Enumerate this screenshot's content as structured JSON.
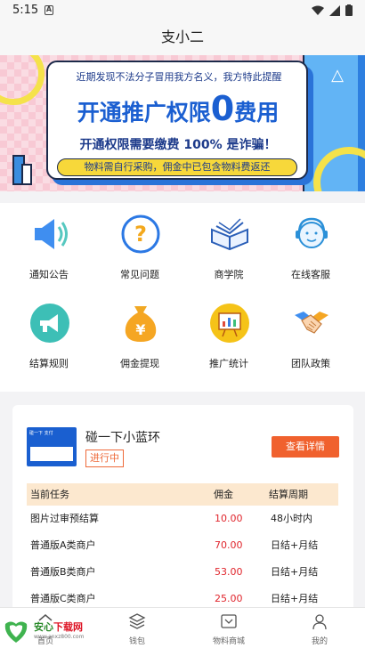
{
  "status_bar": {
    "time": "5:15",
    "notif_letter": "A"
  },
  "header": {
    "title": "支小二"
  },
  "banner": {
    "line1": "近期发现不法分子冒用我方名义，我方特此提醒",
    "line2_a": "开通推广权限",
    "line2_zero": "0",
    "line2_b": "费用",
    "line3": "开通权限需要缴费 100% 是诈骗！",
    "pill": "物料需自行采购，佣金中已包含物料费返还"
  },
  "menu": [
    {
      "label": "通知公告",
      "icon": "speaker-icon"
    },
    {
      "label": "常见问题",
      "icon": "question-icon"
    },
    {
      "label": "商学院",
      "icon": "book-icon"
    },
    {
      "label": "在线客服",
      "icon": "customer-service-icon"
    },
    {
      "label": "结算规则",
      "icon": "megaphone-icon"
    },
    {
      "label": "佣金提现",
      "icon": "money-bag-icon"
    },
    {
      "label": "推广统计",
      "icon": "stats-board-icon"
    },
    {
      "label": "团队政策",
      "icon": "handshake-icon"
    }
  ],
  "task": {
    "name": "碰一下小蓝环",
    "status": "进行中",
    "detail_label": "查看详情",
    "thumb_text": "碰一下 支付"
  },
  "table": {
    "headers": [
      "当前任务",
      "佣金",
      "结算周期"
    ],
    "rows": [
      [
        "图片过审预结算",
        "10.00",
        "48小时内"
      ],
      [
        "普通版A类商户",
        "70.00",
        "日结+月结"
      ],
      [
        "普通版B类商户",
        "53.00",
        "日结+月结"
      ],
      [
        "普通版C类商户",
        "25.00",
        "日结+月结"
      ]
    ]
  },
  "bottom_nav": [
    {
      "label": "首页",
      "icon": "home-icon"
    },
    {
      "label": "钱包",
      "icon": "wallet-icon"
    },
    {
      "label": "物料商城",
      "icon": "shop-icon"
    },
    {
      "label": "我的",
      "icon": "profile-icon"
    }
  ],
  "watermark": {
    "brand_a": "安心",
    "brand_b": "下载网",
    "url": "www.anxz800.com"
  },
  "colors": {
    "accent": "#f0612e",
    "money": "#e0252c",
    "table_head": "#fce8cf",
    "banner_blue": "#1b5fd1"
  }
}
